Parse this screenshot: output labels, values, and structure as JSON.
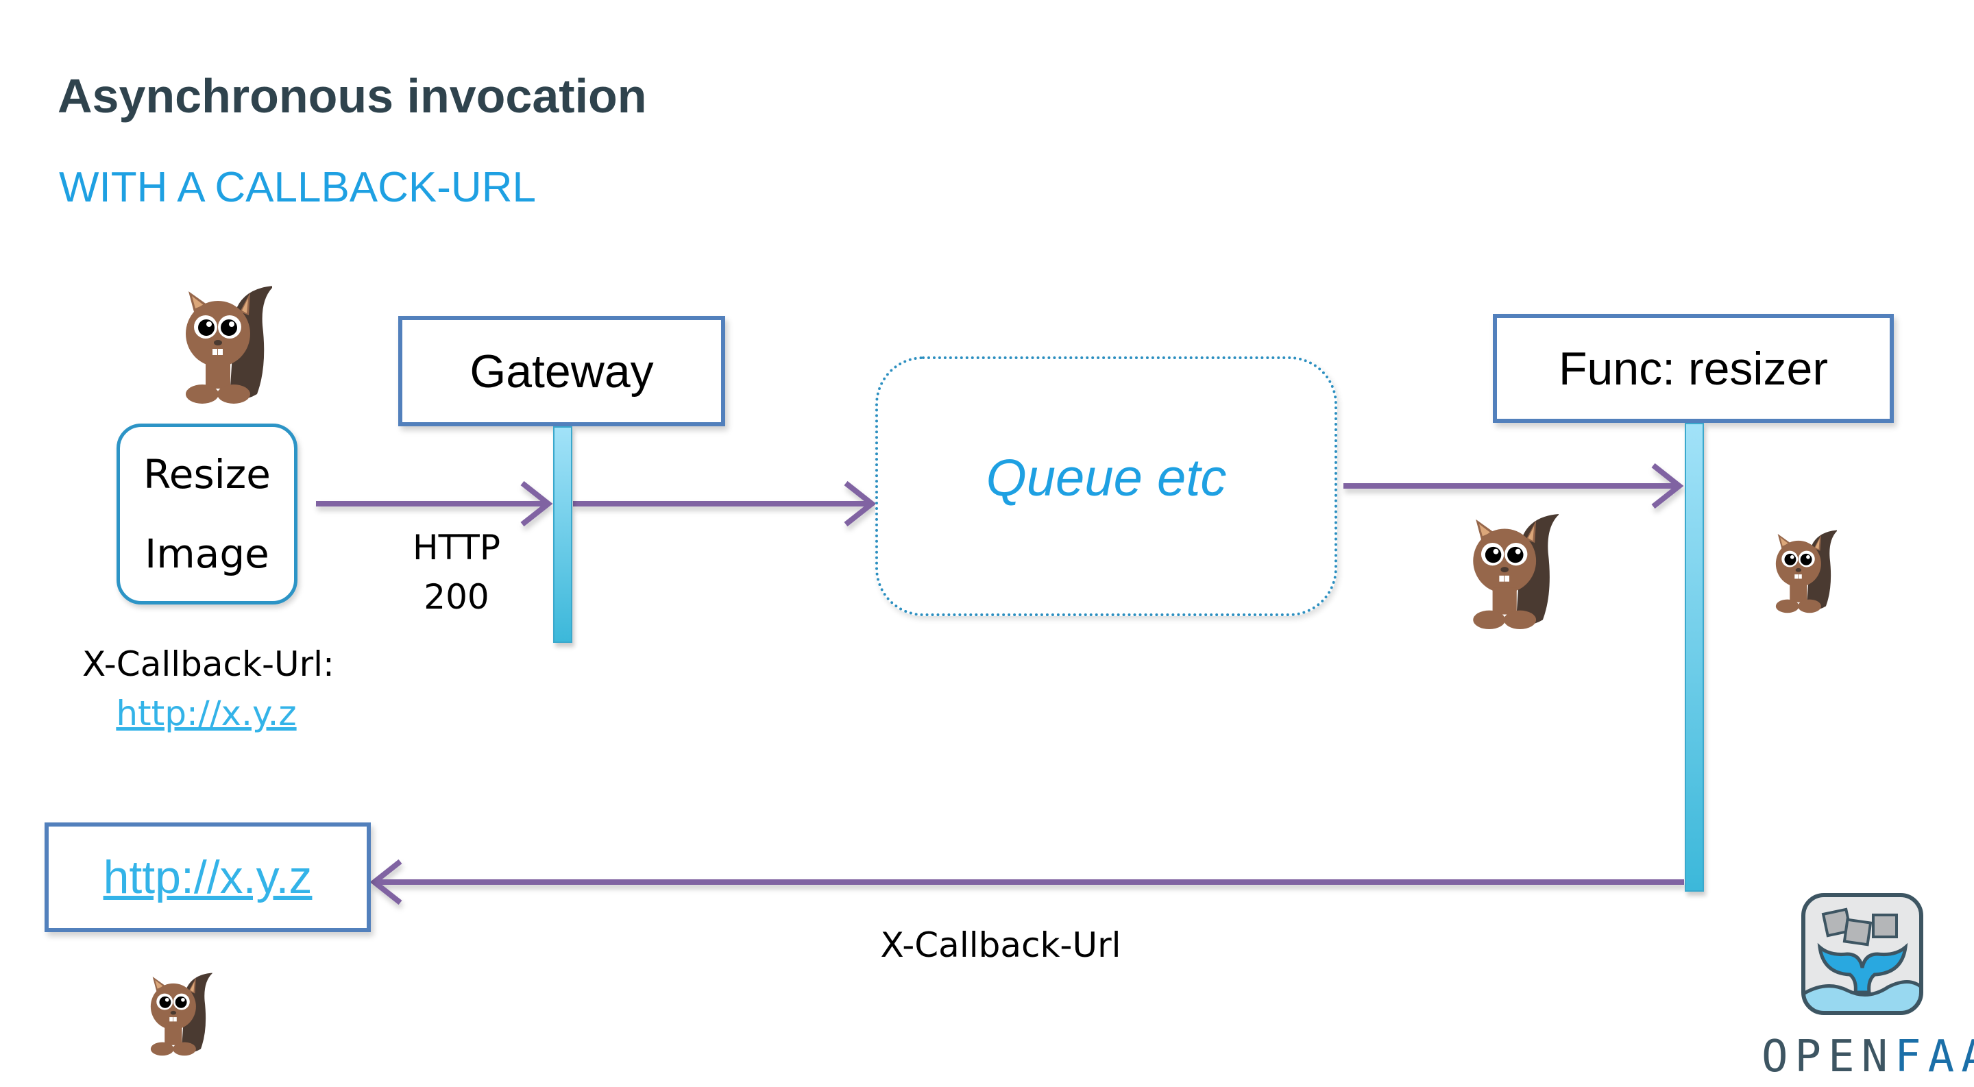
{
  "slide": {
    "title": "Asynchronous invocation",
    "subtitle": "WITH A CALLBACK-URL"
  },
  "nodes": {
    "client": {
      "line1": "Resize",
      "line2": "Image"
    },
    "gateway": {
      "label": "Gateway"
    },
    "queue": {
      "label": "Queue etc"
    },
    "function": {
      "label": "Func: resizer"
    },
    "callback_target": {
      "label": "http://x.y.z"
    }
  },
  "annotations": {
    "http_status_line1": "HTTP",
    "http_status_line2": "200",
    "callback_header_label": "X-Callback-Url:",
    "callback_header_value": "http://x.y.z",
    "return_arrow_label": "X-Callback-Url"
  },
  "logo": {
    "text_open": "OPEN",
    "text_faas": "FAAS"
  },
  "colors": {
    "title": "#2f434d",
    "accent": "#1ea0e2",
    "box_border": "#5280bc",
    "arrow": "#8064a2",
    "lifeline": "#5bc4e4",
    "link": "#33b3e8"
  }
}
